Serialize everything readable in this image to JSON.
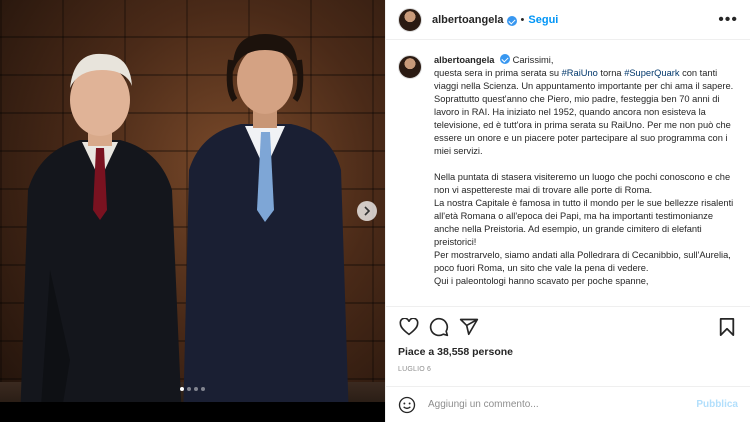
{
  "post": {
    "username": "albertoangela",
    "separator": "•",
    "follow_label": "Segui",
    "more_label": "•••"
  },
  "caption": {
    "username": "albertoangela",
    "lines": [
      "Carissimi,",
      "questa sera in prima serata su #RaiUno torna #SuperQuark con tanti viaggi nella Scienza. Un appuntamento importante per chi ama il sapere. Soprattutto quest'anno che Piero, mio padre, festeggia ben 70 anni di lavoro in RAI. Ha iniziato nel 1952, quando ancora non esisteva la televisione, ed è tutt'ora in prima serata su RaiUno. Per me non può che essere un onore e un piacere poter partecipare al suo programma con i miei servizi.",
      "",
      "Nella puntata di stasera visiteremo un luogo che pochi conoscono e che non vi aspettereste mai di trovare alle porte di Roma.",
      "La nostra Capitale è famosa in tutto il mondo per le sue bellezze risalenti all'età Romana o all'epoca dei Papi, ma ha importanti testimonianze anche nella Preistoria. Ad esempio, un grande cimitero di elefanti preistorici!",
      "Per mostrarvelo, siamo andati alla Polledrara di Cecanibbio, sull'Aurelia, poco fuori Roma, un sito che vale la pena di vedere.",
      "Qui i paleontologi hanno scavato per poche spanne,"
    ]
  },
  "engagement": {
    "likes_text": "Piace a 38,558 persone",
    "date_text": "LUGLIO 6"
  },
  "comment": {
    "placeholder": "Aggiungi un commento...",
    "publish_label": "Pubblica"
  },
  "carousel": {
    "slide_count": 4,
    "active_index": 0
  },
  "colors": {
    "accent": "#0095f6",
    "verified": "#3897f0",
    "hashtag": "#00376b",
    "publish_disabled": "#b2dffc"
  }
}
